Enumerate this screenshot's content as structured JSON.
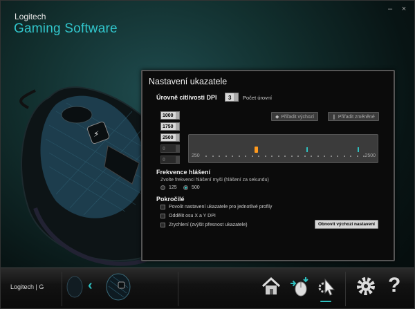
{
  "app": {
    "brand_top": "Logitech",
    "brand_main": "Gaming Software",
    "brand_color": "#31c6cc"
  },
  "window_controls": {
    "minimize": "–",
    "close": "×"
  },
  "panel": {
    "title": "Nastavení ukazatele",
    "dpi": {
      "section_title": "Úrovně citlivosti DPI",
      "count_value": "3",
      "count_label": "Počet úrovní",
      "levels": [
        "1000",
        "1750",
        "2500",
        "0",
        "0"
      ],
      "assign_default_label": "Přiřadit výchozí",
      "assign_shift_label": "Přiřadit změněné",
      "slider_min": "250",
      "slider_max": "2500",
      "accent_color": "#2fc0c0",
      "active_color": "#ff9a1e"
    },
    "report_rate": {
      "section_title": "Frekvence hlášení",
      "description": "Zvolte frekvenci hlášení myši (hlášení za sekundu)",
      "options": [
        "125",
        "500"
      ],
      "selected": "500"
    },
    "advanced": {
      "section_title": "Pokročilé",
      "options": [
        "Povolit nastavení ukazatele pro jednotlivé profily",
        "Oddělit osu X a Y DPI",
        "Zrychlení (zvýšit přesnost ukazatele)"
      ],
      "reset_label": "Obnovit výchozí nastavení"
    }
  },
  "bottom_bar": {
    "logo_text": "Logitech | G",
    "icons": [
      "home-icon",
      "customize-buttons-icon",
      "pointer-settings-icon",
      "settings-gear-icon",
      "help-icon"
    ],
    "help_glyph": "?"
  }
}
